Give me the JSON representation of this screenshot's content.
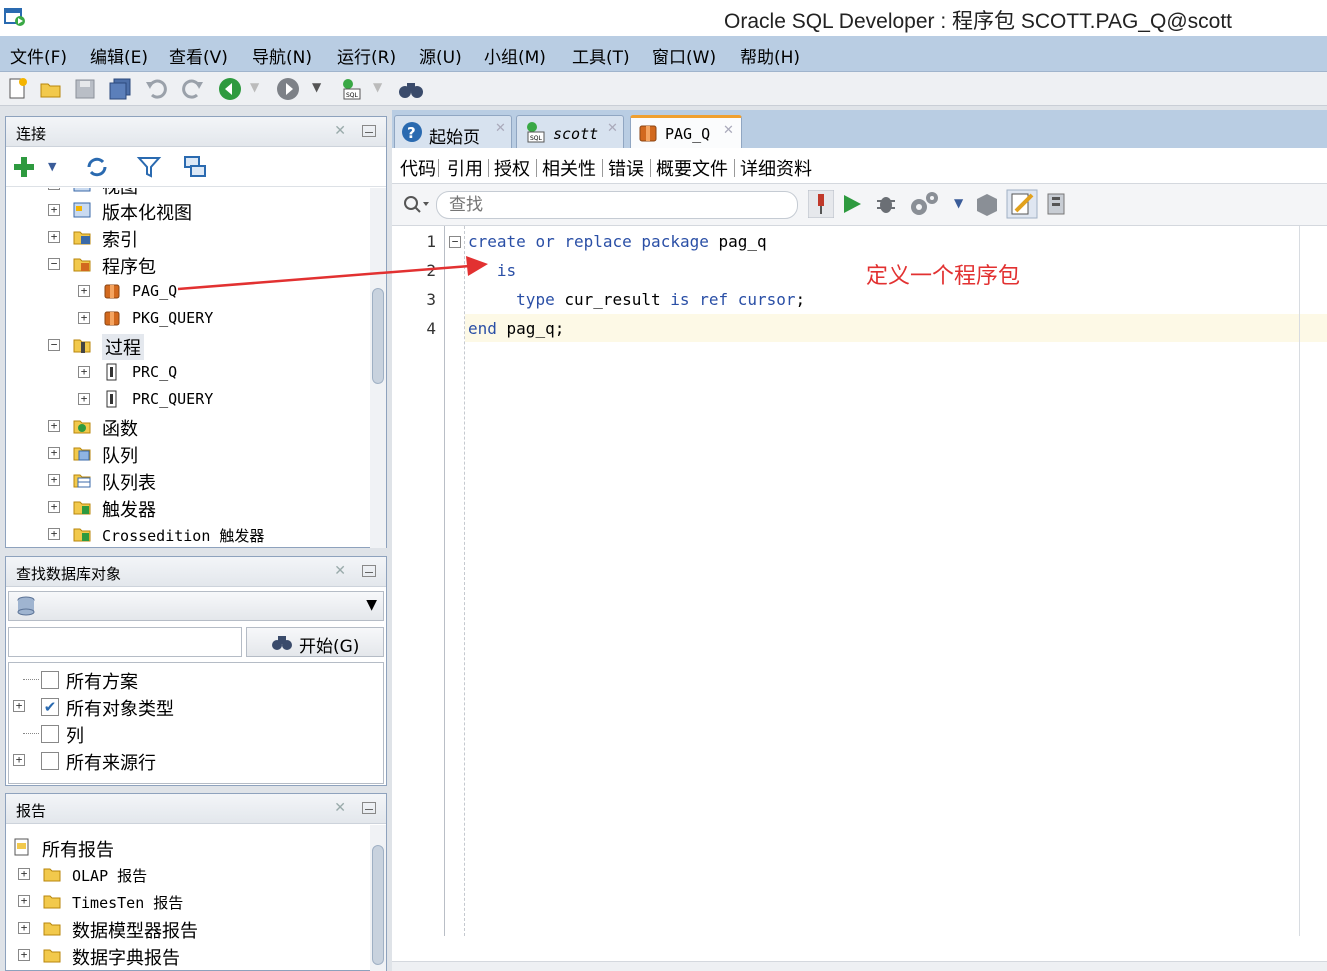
{
  "window": {
    "title": "Oracle SQL Developer : 程序包 SCOTT.PAG_Q@scott"
  },
  "menu": [
    "文件(F)",
    "编辑(E)",
    "查看(V)",
    "导航(N)",
    "运行(R)",
    "源(U)",
    "小组(M)",
    "工具(T)",
    "窗口(W)",
    "帮助(H)"
  ],
  "connections_panel": {
    "title": "连接",
    "tree": [
      {
        "label": "视图",
        "mono": false,
        "icon": "view-icon"
      },
      {
        "label": "版本化视图",
        "mono": false,
        "icon": "view-icon"
      },
      {
        "label": "索引",
        "mono": false,
        "icon": "index-icon"
      },
      {
        "label": "程序包",
        "mono": false,
        "icon": "package-folder-icon"
      },
      {
        "label": "PAG_Q",
        "mono": true,
        "icon": "package-icon"
      },
      {
        "label": "PKG_QUERY",
        "mono": true,
        "icon": "package-icon"
      },
      {
        "label": "过程",
        "mono": false,
        "icon": "procedure-folder-icon"
      },
      {
        "label": "PRC_Q",
        "mono": true,
        "icon": "procedure-icon"
      },
      {
        "label": "PRC_QUERY",
        "mono": true,
        "icon": "procedure-icon"
      },
      {
        "label": "函数",
        "mono": false,
        "icon": "function-icon"
      },
      {
        "label": "队列",
        "mono": false,
        "icon": "queue-icon"
      },
      {
        "label": "队列表",
        "mono": false,
        "icon": "queue-table-icon"
      },
      {
        "label": "触发器",
        "mono": false,
        "icon": "trigger-icon"
      },
      {
        "label": "Crossedition 触发器",
        "mono": false,
        "icon": "trigger-icon"
      }
    ]
  },
  "find_panel": {
    "title": "查找数据库对象",
    "go_button": "开始(G)",
    "options": [
      {
        "label": "所有方案",
        "checked": false
      },
      {
        "label": "所有对象类型",
        "checked": true
      },
      {
        "label": "列",
        "checked": false
      },
      {
        "label": "所有来源行",
        "checked": false
      }
    ]
  },
  "reports_panel": {
    "title": "报告",
    "items": [
      "所有报告",
      "OLAP 报告",
      "TimesTen 报告",
      "数据模型器报告",
      "数据字典报告"
    ]
  },
  "editor": {
    "tabs": [
      {
        "label": "起始页",
        "icon": "help-icon"
      },
      {
        "label": "scott",
        "icon": "sql-connection-icon"
      },
      {
        "label": "PAG_Q",
        "icon": "package-icon"
      }
    ],
    "sub_tabs": [
      "代码",
      "引用",
      "授权",
      "相关性",
      "错误",
      "概要文件",
      "详细资料"
    ],
    "search_placeholder": "查找",
    "line_numbers": [
      "1",
      "2",
      "3",
      "4"
    ],
    "annotation": "定义一个程序包"
  },
  "colors": {
    "menubar": "#b9cde3",
    "keyword": "#2a4fa6",
    "annotation": "#e23131",
    "current_line": "#fdf9e6"
  }
}
